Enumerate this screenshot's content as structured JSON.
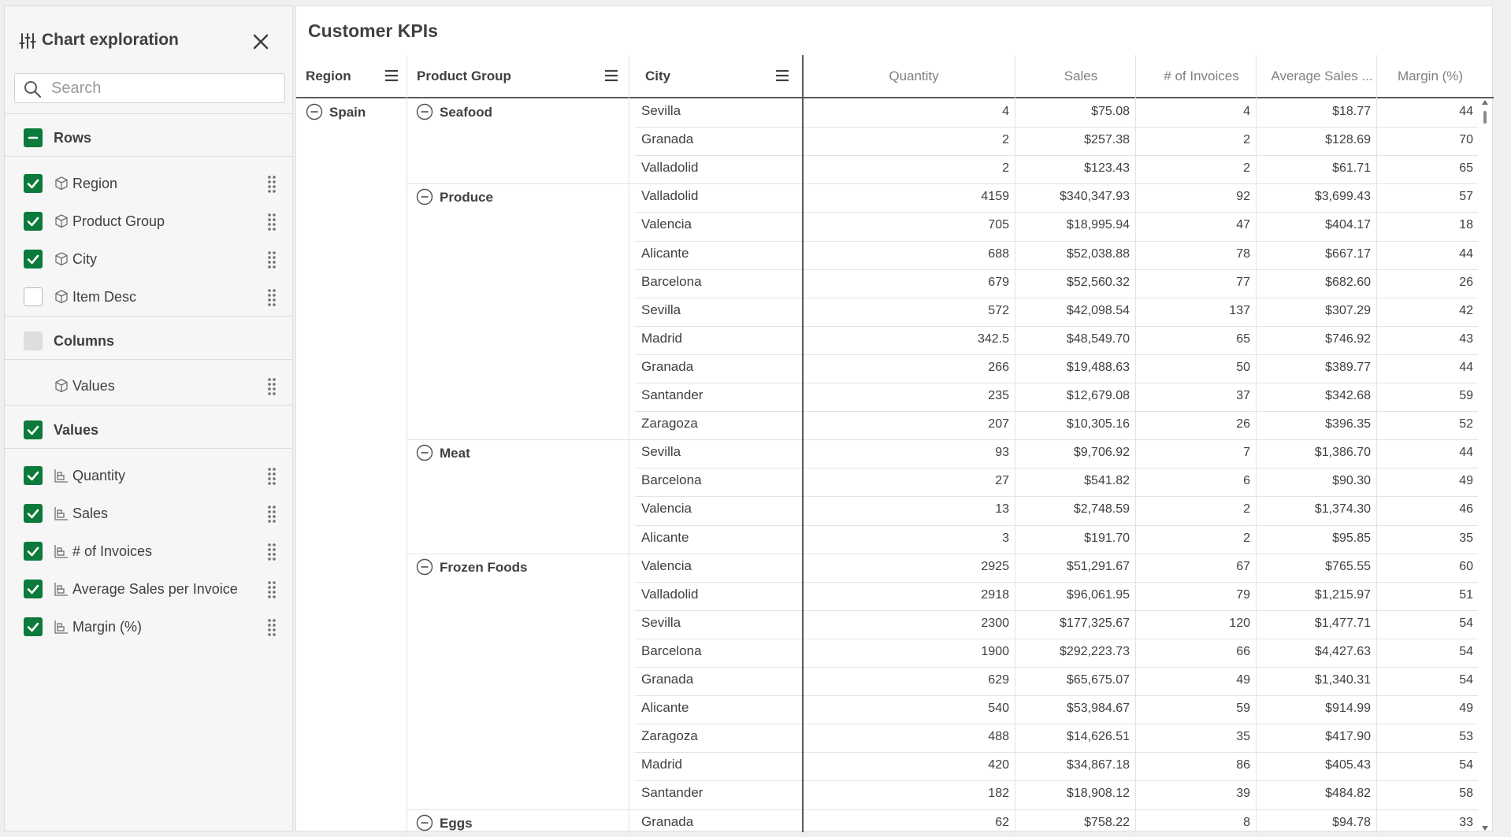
{
  "panel": {
    "title": "Chart exploration",
    "search_placeholder": "Search",
    "rows_section": {
      "label": "Rows",
      "items": [
        {
          "label": "Region",
          "checked": true
        },
        {
          "label": "Product Group",
          "checked": true
        },
        {
          "label": "City",
          "checked": true
        },
        {
          "label": "Item Desc",
          "checked": false
        }
      ]
    },
    "columns_section": {
      "label": "Columns",
      "items": [
        {
          "label": "Values"
        }
      ]
    },
    "values_section": {
      "label": "Values",
      "items": [
        {
          "label": "Quantity",
          "checked": true
        },
        {
          "label": "Sales",
          "checked": true
        },
        {
          "label": "# of Invoices",
          "checked": true
        },
        {
          "label": "Average Sales per Invoice",
          "checked": true
        },
        {
          "label": "Margin (%)",
          "checked": true
        }
      ]
    }
  },
  "table": {
    "title": "Customer KPIs",
    "headers": {
      "region": "Region",
      "product_group": "Product Group",
      "city": "City",
      "quantity": "Quantity",
      "sales": "Sales",
      "invoices": "# of Invoices",
      "avg_sales": "Average Sales ...",
      "margin": "Margin (%)"
    },
    "region": "Spain",
    "groups": [
      {
        "name": "Seafood",
        "rows": [
          [
            "Sevilla",
            "4",
            "$75.08",
            "4",
            "$18.77",
            "44"
          ],
          [
            "Granada",
            "2",
            "$257.38",
            "2",
            "$128.69",
            "70"
          ],
          [
            "Valladolid",
            "2",
            "$123.43",
            "2",
            "$61.71",
            "65"
          ]
        ]
      },
      {
        "name": "Produce",
        "rows": [
          [
            "Valladolid",
            "4159",
            "$340,347.93",
            "92",
            "$3,699.43",
            "57"
          ],
          [
            "Valencia",
            "705",
            "$18,995.94",
            "47",
            "$404.17",
            "18"
          ],
          [
            "Alicante",
            "688",
            "$52,038.88",
            "78",
            "$667.17",
            "44"
          ],
          [
            "Barcelona",
            "679",
            "$52,560.32",
            "77",
            "$682.60",
            "26"
          ],
          [
            "Sevilla",
            "572",
            "$42,098.54",
            "137",
            "$307.29",
            "42"
          ],
          [
            "Madrid",
            "342.5",
            "$48,549.70",
            "65",
            "$746.92",
            "43"
          ],
          [
            "Granada",
            "266",
            "$19,488.63",
            "50",
            "$389.77",
            "44"
          ],
          [
            "Santander",
            "235",
            "$12,679.08",
            "37",
            "$342.68",
            "59"
          ],
          [
            "Zaragoza",
            "207",
            "$10,305.16",
            "26",
            "$396.35",
            "52"
          ]
        ]
      },
      {
        "name": "Meat",
        "rows": [
          [
            "Sevilla",
            "93",
            "$9,706.92",
            "7",
            "$1,386.70",
            "44"
          ],
          [
            "Barcelona",
            "27",
            "$541.82",
            "6",
            "$90.30",
            "49"
          ],
          [
            "Valencia",
            "13",
            "$2,748.59",
            "2",
            "$1,374.30",
            "46"
          ],
          [
            "Alicante",
            "3",
            "$191.70",
            "2",
            "$95.85",
            "35"
          ]
        ]
      },
      {
        "name": "Frozen Foods",
        "rows": [
          [
            "Valencia",
            "2925",
            "$51,291.67",
            "67",
            "$765.55",
            "60"
          ],
          [
            "Valladolid",
            "2918",
            "$96,061.95",
            "79",
            "$1,215.97",
            "51"
          ],
          [
            "Sevilla",
            "2300",
            "$177,325.67",
            "120",
            "$1,477.71",
            "54"
          ],
          [
            "Barcelona",
            "1900",
            "$292,223.73",
            "66",
            "$4,427.63",
            "54"
          ],
          [
            "Granada",
            "629",
            "$65,675.07",
            "49",
            "$1,340.31",
            "54"
          ],
          [
            "Alicante",
            "540",
            "$53,984.67",
            "59",
            "$914.99",
            "49"
          ],
          [
            "Zaragoza",
            "488",
            "$14,626.51",
            "35",
            "$417.90",
            "53"
          ],
          [
            "Madrid",
            "420",
            "$34,867.18",
            "86",
            "$405.43",
            "54"
          ],
          [
            "Santander",
            "182",
            "$18,908.12",
            "39",
            "$484.82",
            "58"
          ]
        ]
      },
      {
        "name": "Eggs",
        "rows": [
          [
            "Granada",
            "62",
            "$758.22",
            "8",
            "$94.78",
            "33"
          ]
        ]
      }
    ]
  },
  "colors": {
    "check_green": "#0b7a3b",
    "text": "#404040",
    "muted": "#808080"
  }
}
